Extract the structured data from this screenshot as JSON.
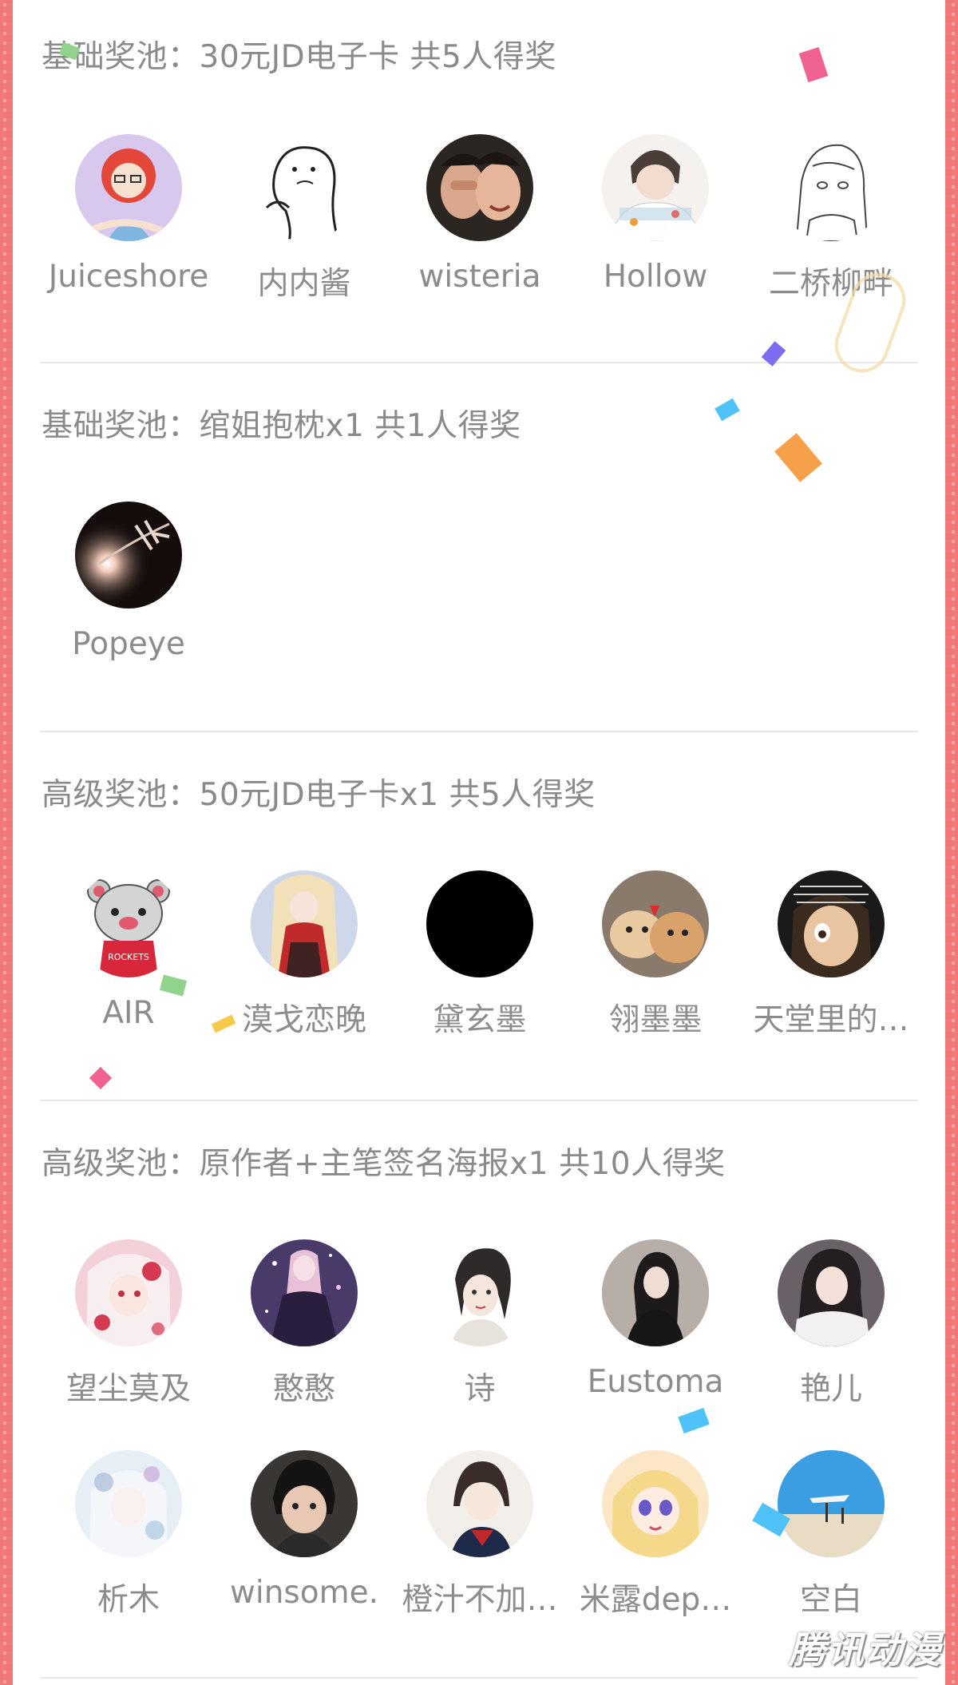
{
  "sections": [
    {
      "title": "基础奖池：30元JD电子卡 共5人得奖",
      "winners": [
        {
          "name": "Juiceshore"
        },
        {
          "name": "内内酱"
        },
        {
          "name": "wisteria"
        },
        {
          "name": "Hollow"
        },
        {
          "name": "二桥柳畔"
        }
      ]
    },
    {
      "title": "基础奖池：绾姐抱枕x1 共1人得奖",
      "winners": [
        {
          "name": "Popeye"
        }
      ]
    },
    {
      "title": "高级奖池：50元JD电子卡x1 共5人得奖",
      "winners": [
        {
          "name": "AIR"
        },
        {
          "name": "漠戈恋晚"
        },
        {
          "name": "黛玄墨"
        },
        {
          "name": "翎墨墨"
        },
        {
          "name": "天堂里的…"
        }
      ]
    },
    {
      "title": "高级奖池：原作者+主笔签名海报x1 共10人得奖",
      "winners": [
        {
          "name": "望尘莫及"
        },
        {
          "name": "憨憨"
        },
        {
          "name": "诗"
        },
        {
          "name": "Eustoma"
        },
        {
          "name": "艳儿"
        },
        {
          "name": "析木"
        },
        {
          "name": "winsome."
        },
        {
          "name": "橙汁不加…"
        },
        {
          "name": "米露dep…"
        },
        {
          "name": "空白"
        }
      ]
    }
  ],
  "watermark": "腾讯动漫",
  "colors": {
    "frame": "#f07878",
    "panel": "#ffffff",
    "text": "#8a8a8a",
    "divider": "#e8e8e8"
  }
}
